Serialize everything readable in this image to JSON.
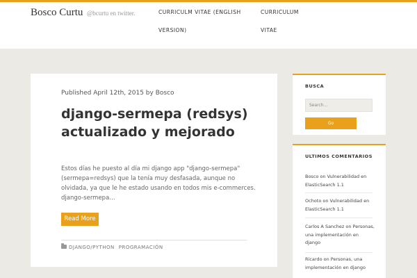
{
  "site": {
    "title": "Bosco Curtu",
    "tagline": "@bcurtu en twitter."
  },
  "nav": {
    "items": [
      {
        "label": "CURRICULM VITAE (ENGLISH VERSION)"
      },
      {
        "label": "CURRICULUM VITAE"
      }
    ]
  },
  "post": {
    "byline": "Published April 12th, 2015 by Bosco",
    "title": "django-sermepa (redsys) actualizado y mejorado",
    "excerpt": "Estos días he puesto al día mi django app \"django-sermepa\" (sermepa=redsys) que la tenía muy desfasada, aunque no olvidada, ya que le he estado usando en todos mis e-commerces. django-sermepa…",
    "readmore_label": "Read More",
    "tags": [
      "DJANGO/PYTHON",
      "PROGRAMACIÓN"
    ]
  },
  "sidebar": {
    "search": {
      "title": "BUSCA",
      "placeholder": "Search…",
      "button_label": "Go"
    },
    "comments": {
      "title": "ULTIMOS COMENTARIOS",
      "items": [
        {
          "text": "Bosco on Vulnerabilidad en ElasticSearch 1.1"
        },
        {
          "text": "Ochoto on Vulnerabilidad en ElasticSearch 1.1"
        },
        {
          "text": "Carlos A Sanchez on Personas, una implementación en django"
        },
        {
          "text": "Ricardo on Personas, una implementación en django"
        }
      ]
    }
  },
  "colors": {
    "accent": "#e9a11b",
    "background": "#ebeae5",
    "card": "#ffffff"
  }
}
